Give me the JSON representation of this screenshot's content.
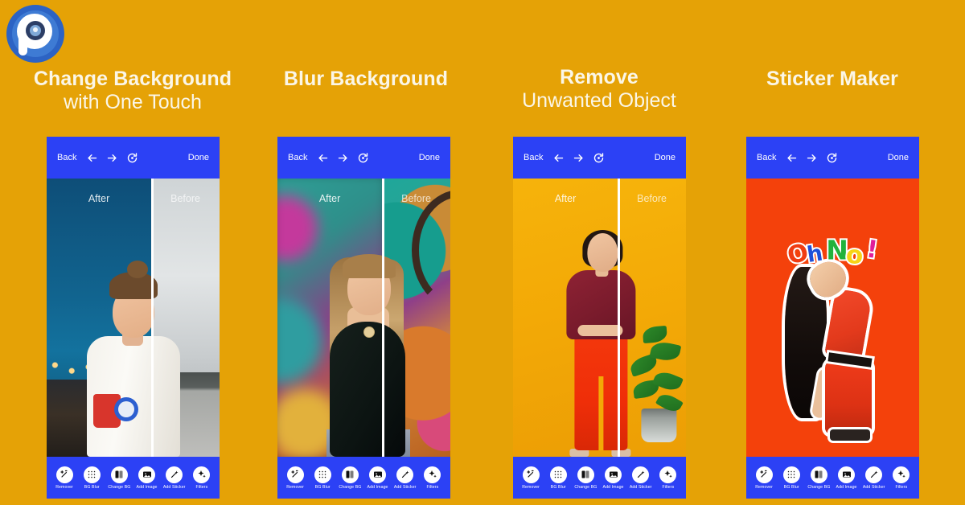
{
  "page": {
    "background_color": "#E5A206",
    "logo": {
      "name": "photo-editor-logo",
      "colors": {
        "outer": "#2C63C4",
        "inner": "#3E7BD4",
        "mark": "#FFFFFF",
        "lens": "#2C3E66"
      }
    }
  },
  "theme": {
    "accent_blue": "#2C41F5",
    "title_color": "#FBF6E7",
    "sticker_bg": "#F4410B"
  },
  "columns": [
    {
      "id": "change-background",
      "title_line1": "Change Background",
      "title_line2": "with One Touch",
      "phone": {
        "header": {
          "back": "Back",
          "done": "Done",
          "icons": [
            "arrow-left-icon",
            "arrow-right-icon",
            "reset-icon"
          ]
        },
        "compare": {
          "after_label": "After",
          "before_label": "Before"
        },
        "toolbar": [
          {
            "label": "Remover",
            "icon": "magic-wand-icon"
          },
          {
            "label": "BG Blur",
            "icon": "grid-dots-icon"
          },
          {
            "label": "Change BG",
            "icon": "swap-image-icon"
          },
          {
            "label": "Add Image",
            "icon": "picture-icon"
          },
          {
            "label": "Add Sticker",
            "icon": "sticker-wand-icon"
          },
          {
            "label": "Filters",
            "icon": "sparkle-icon"
          }
        ]
      }
    },
    {
      "id": "blur-background",
      "title_line1": "Blur Background",
      "title_line2": "",
      "phone": {
        "header": {
          "back": "Back",
          "done": "Done",
          "icons": [
            "arrow-left-icon",
            "arrow-right-icon",
            "reset-icon"
          ]
        },
        "compare": {
          "after_label": "After",
          "before_label": "Before"
        },
        "toolbar": [
          {
            "label": "Remover",
            "icon": "magic-wand-icon"
          },
          {
            "label": "BG Blur",
            "icon": "grid-dots-icon"
          },
          {
            "label": "Change BG",
            "icon": "swap-image-icon"
          },
          {
            "label": "Add Image",
            "icon": "picture-icon"
          },
          {
            "label": "Add Sticker",
            "icon": "sticker-wand-icon"
          },
          {
            "label": "Filters",
            "icon": "sparkle-icon"
          }
        ]
      }
    },
    {
      "id": "remove-unwanted-object",
      "title_line1": "Remove",
      "title_line2": "Unwanted Object",
      "phone": {
        "header": {
          "back": "Back",
          "done": "Done",
          "icons": [
            "arrow-left-icon",
            "arrow-right-icon",
            "reset-icon"
          ]
        },
        "compare": {
          "after_label": "After",
          "before_label": "Before"
        },
        "toolbar": [
          {
            "label": "Remover",
            "icon": "magic-wand-icon"
          },
          {
            "label": "BG Blur",
            "icon": "grid-dots-icon"
          },
          {
            "label": "Change BG",
            "icon": "swap-image-icon"
          },
          {
            "label": "Add Image",
            "icon": "picture-icon"
          },
          {
            "label": "Add Sticker",
            "icon": "sticker-wand-icon"
          },
          {
            "label": "Filters",
            "icon": "sparkle-icon"
          }
        ]
      }
    },
    {
      "id": "sticker-maker",
      "title_line1": "Sticker Maker",
      "title_line2": "",
      "phone": {
        "header": {
          "back": "Back",
          "done": "Done",
          "icons": [
            "arrow-left-icon",
            "arrow-right-icon",
            "reset-icon"
          ]
        },
        "sticker_text": {
          "o1": "O",
          "h": "h",
          "n": "N",
          "o2": "o",
          "ex": "!"
        },
        "toolbar": [
          {
            "label": "Remover",
            "icon": "magic-wand-icon"
          },
          {
            "label": "BG Blur",
            "icon": "grid-dots-icon"
          },
          {
            "label": "Change BG",
            "icon": "swap-image-icon"
          },
          {
            "label": "Add Image",
            "icon": "picture-icon"
          },
          {
            "label": "Add Sticker",
            "icon": "sticker-wand-icon"
          },
          {
            "label": "Filters",
            "icon": "sparkle-icon"
          }
        ]
      }
    }
  ]
}
